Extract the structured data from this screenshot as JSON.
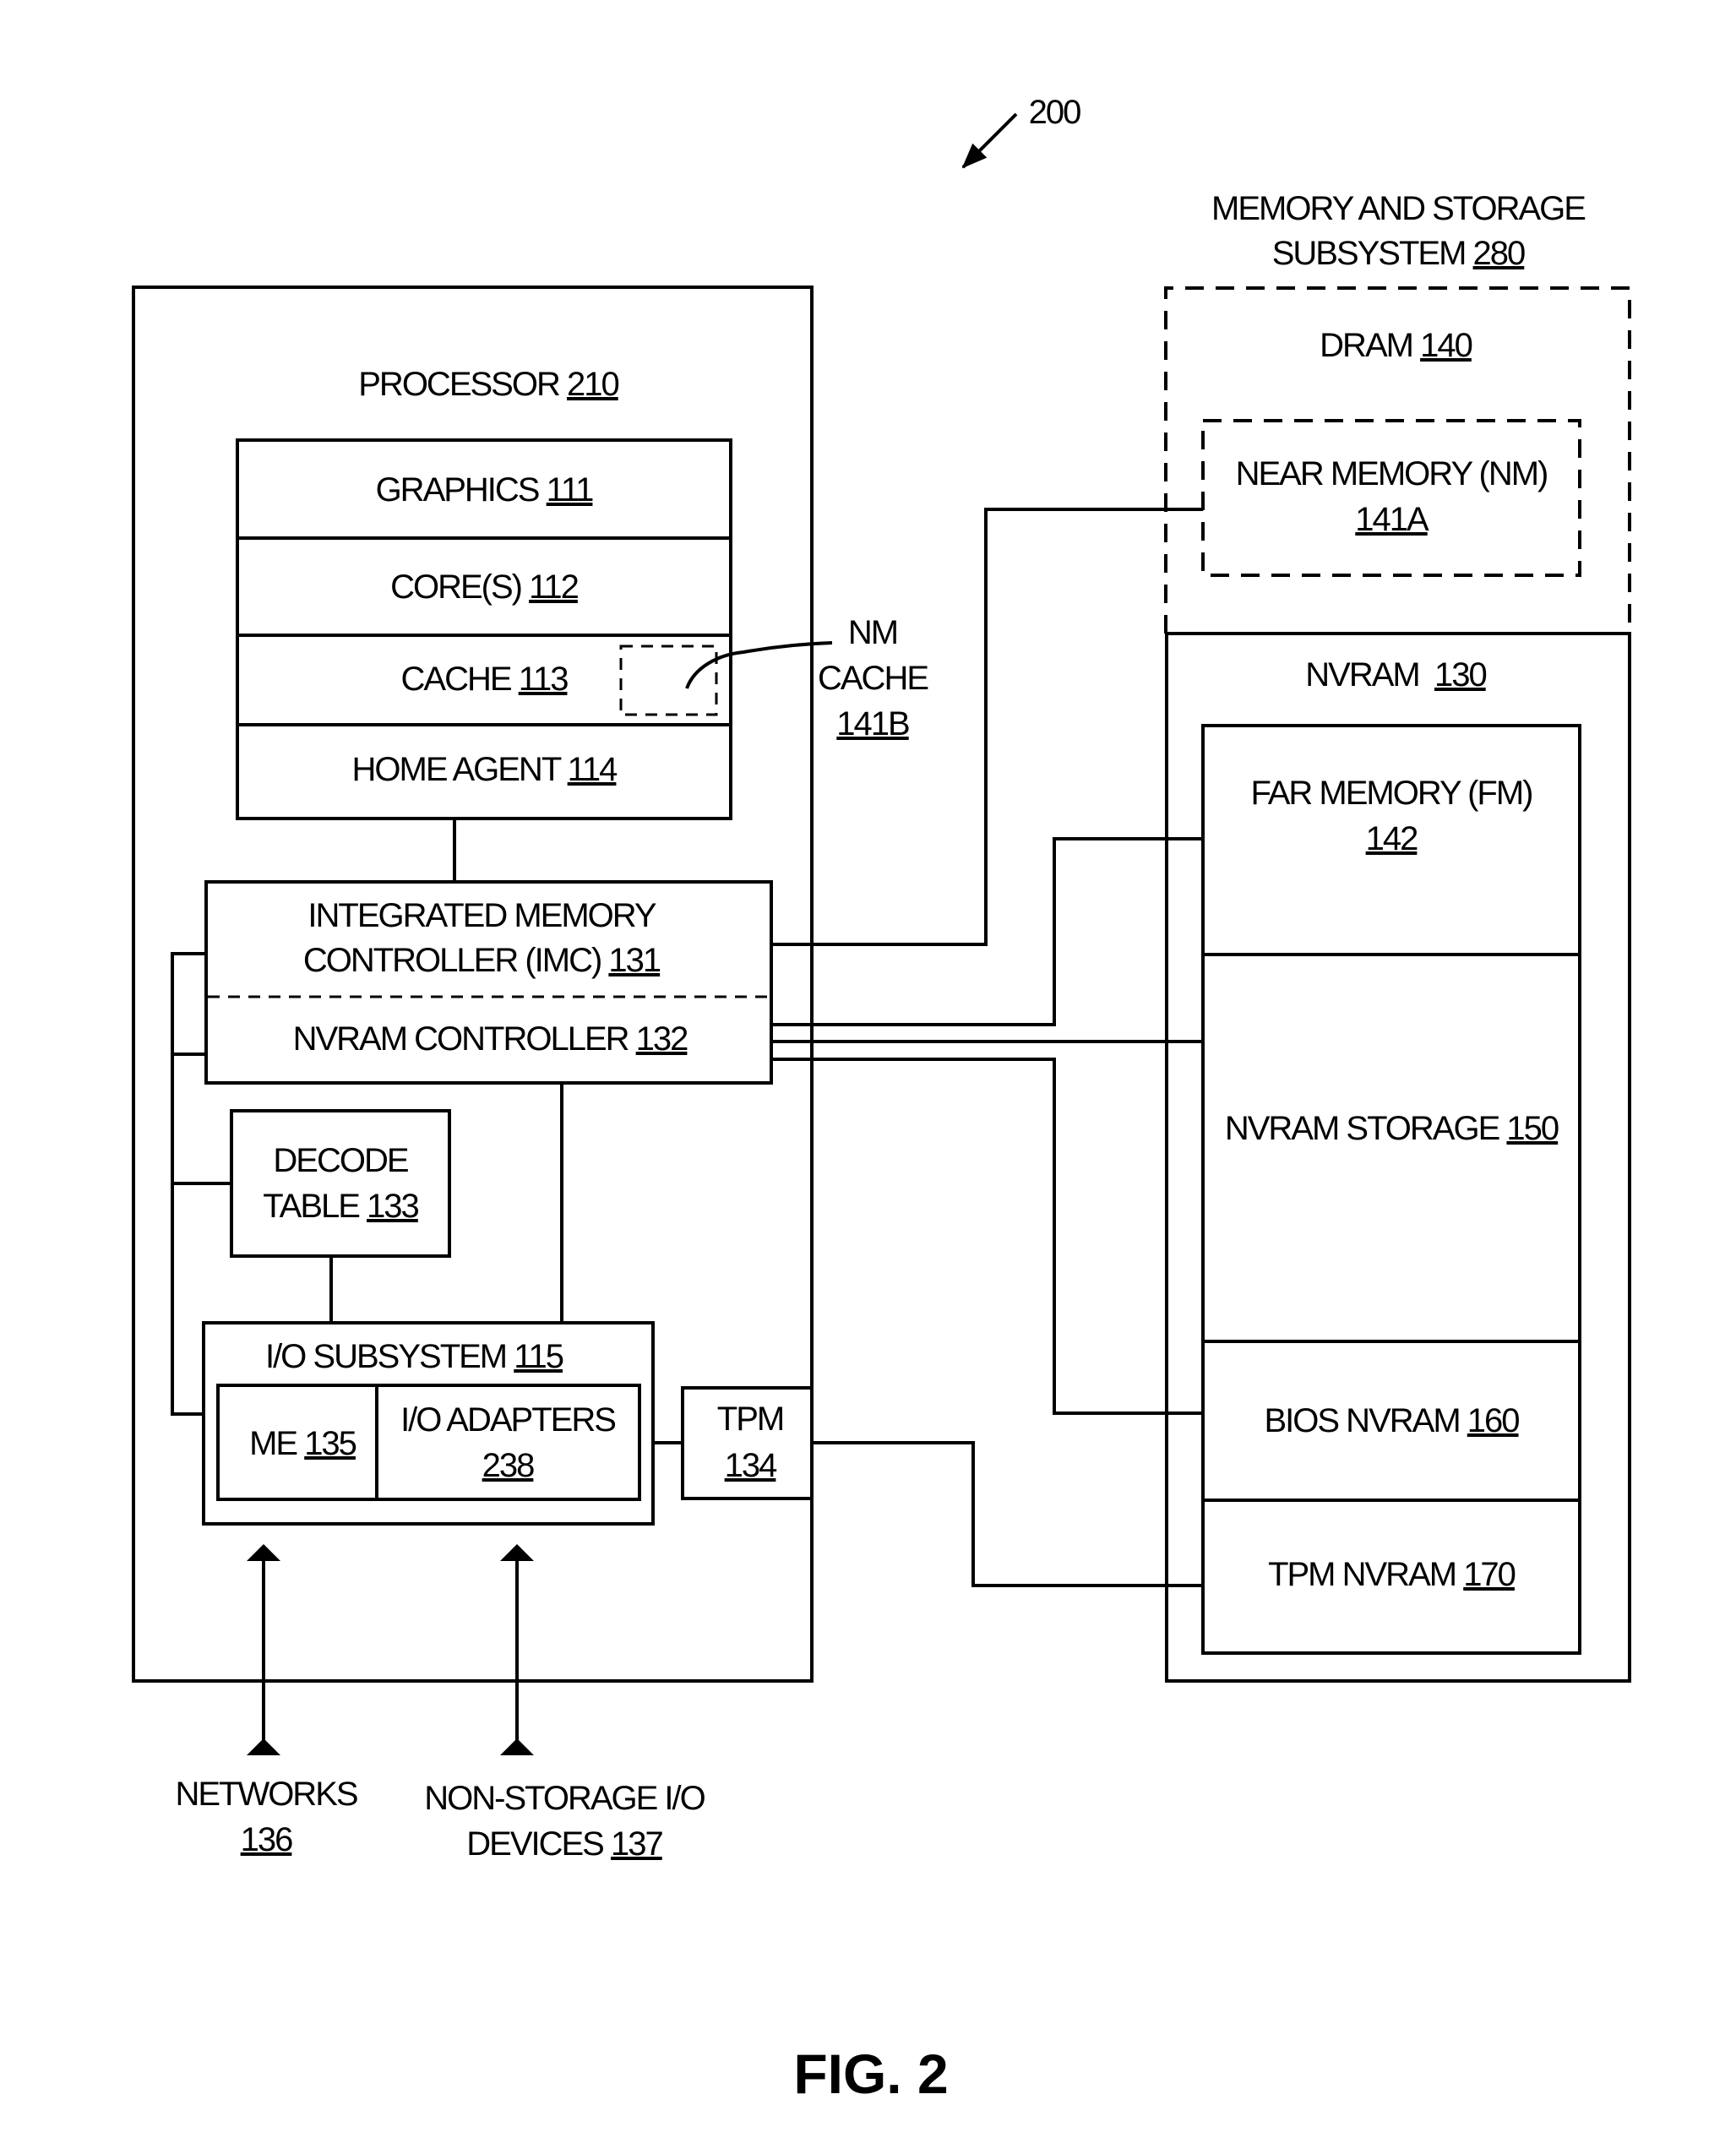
{
  "figure": {
    "reference_number": "200",
    "caption": "FIG. 2"
  },
  "processor": {
    "title": "PROCESSOR",
    "ref": "210",
    "graphics": {
      "label": "GRAPHICS",
      "ref": "111"
    },
    "cores": {
      "label": "CORE(S)",
      "ref": "112"
    },
    "cache": {
      "label": "CACHE",
      "ref": "113"
    },
    "home_agent": {
      "label": "HOME AGENT",
      "ref": "114"
    },
    "imc": {
      "line1": "INTEGRATED MEMORY",
      "line2": "CONTROLLER (IMC)",
      "ref": "131"
    },
    "nvram_controller": {
      "label": "NVRAM CONTROLLER",
      "ref": "132"
    },
    "decode_table": {
      "line1": "DECODE",
      "line2": "TABLE",
      "ref": "133"
    },
    "io_subsystem": {
      "label": "I/O SUBSYSTEM",
      "ref": "115"
    },
    "me": {
      "label": "ME",
      "ref": "135"
    },
    "io_adapters": {
      "label": "I/O ADAPTERS",
      "ref": "238"
    },
    "tpm": {
      "label": "TPM",
      "ref": "134"
    }
  },
  "nm_cache": {
    "line1": "NM",
    "line2": "CACHE",
    "ref": "141B"
  },
  "memory_storage": {
    "title_line1": "MEMORY AND STORAGE",
    "title_line2": "SUBSYSTEM",
    "ref": "280",
    "dram": {
      "label": "DRAM",
      "ref": "140"
    },
    "near_memory": {
      "label": "NEAR MEMORY (NM)",
      "ref": "141A"
    },
    "nvram": {
      "label": "NVRAM  ",
      "ref": "130"
    },
    "far_memory": {
      "label": "FAR MEMORY (FM)",
      "ref": "142"
    },
    "nvram_storage": {
      "label": "NVRAM STORAGE",
      "ref": "150"
    },
    "bios_nvram": {
      "label": "BIOS NVRAM",
      "ref": "160"
    },
    "tpm_nvram": {
      "label": "TPM NVRAM",
      "ref": "170"
    }
  },
  "external": {
    "networks": {
      "label": "NETWORKS",
      "ref": "136"
    },
    "non_storage_io": {
      "line1": "NON-STORAGE I/O",
      "line2": "DEVICES",
      "ref": "137"
    }
  }
}
